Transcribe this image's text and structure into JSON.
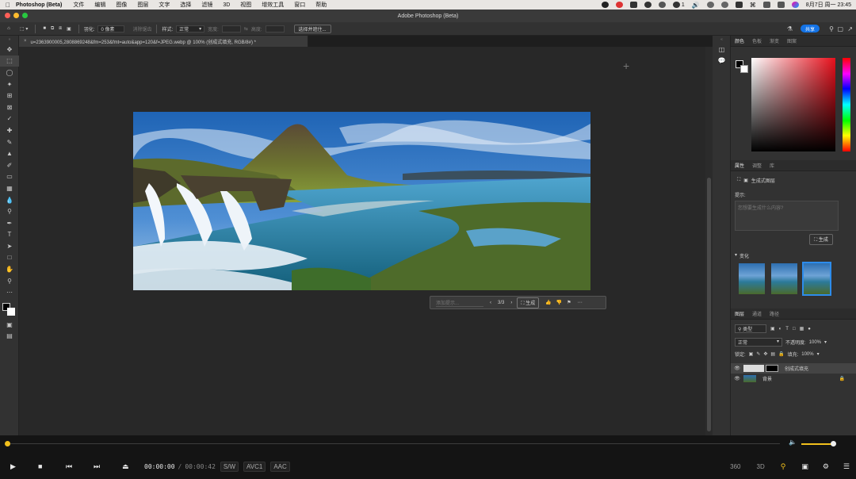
{
  "menubar": {
    "app_name": "Photoshop (Beta)",
    "items": [
      "文件",
      "编辑",
      "图像",
      "图层",
      "文字",
      "选择",
      "滤镜",
      "3D",
      "视图",
      "增效工具",
      "窗口",
      "帮助"
    ],
    "status_badge": "1",
    "clock": "8月7日 周一  23:45"
  },
  "window": {
    "title": "Adobe Photoshop (Beta)"
  },
  "options_bar": {
    "feather_label": "羽化:",
    "feather_value": "0 像素",
    "antialias_label": "消除锯齿",
    "style_label": "样式:",
    "style_value": "正常",
    "width_label": "宽度:",
    "height_label": "高度:",
    "select_mask_button": "选择并遮住...",
    "share_button": "共享"
  },
  "document": {
    "tab_title": "u=2363900005,2808869248&fm=253&fmt=auto&app=120&f=JPEG.webp @ 100% (创成式填充, RGB/8#) *"
  },
  "gen_bar": {
    "placeholder": "添加提示...",
    "counter": "3/3",
    "generate_button": "生成"
  },
  "panels": {
    "color_tabs": [
      "颜色",
      "色板",
      "渐变",
      "图案"
    ],
    "props_tabs": [
      "属性",
      "调整",
      "库"
    ],
    "props_layer_type": "生成式图层",
    "prompt_label": "提示:",
    "prompt_placeholder": "您想要生成什么内容?",
    "generate_button": "生成",
    "variations_label": "变化",
    "layer_tabs": [
      "图层",
      "通道",
      "路径"
    ],
    "kind_filter": "类型",
    "blend_mode": "正常",
    "opacity_label": "不透明度:",
    "opacity_value": "100%",
    "lock_label": "锁定:",
    "fill_label": "填充:",
    "fill_value": "100%",
    "layers": [
      {
        "name": "创成式填充",
        "selected": true
      },
      {
        "name": "背景",
        "selected": false
      }
    ]
  },
  "player": {
    "current_time": "00:00:00",
    "separator": "/",
    "total_time": "00:00:42",
    "tags": [
      "S/W",
      "AVC1",
      "AAC"
    ],
    "vr_label": "360",
    "threed_label": "3D",
    "progress": 0.0,
    "volume": 0.9
  }
}
